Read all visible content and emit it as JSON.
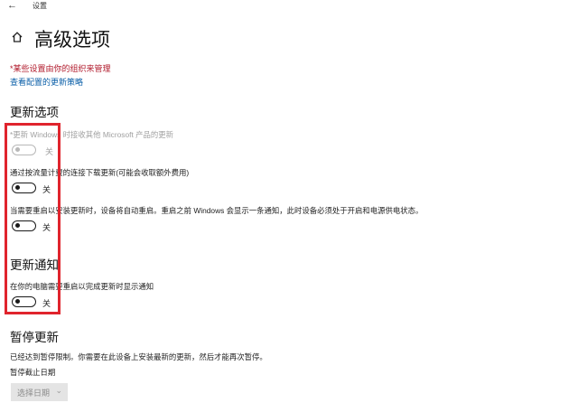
{
  "titlebar": {
    "back_icon": "back-arrow-icon",
    "title": "设置"
  },
  "page": {
    "home_icon": "home-icon",
    "title": "高级选项"
  },
  "managed_note": "*某些设置由你的组织来管理",
  "policy_link": "查看配置的更新策略",
  "update_options": {
    "heading": "更新选项",
    "items": [
      {
        "label": "*更新 Windows 时接收其他 Microsoft 产品的更新",
        "state": "关",
        "enabled": false
      },
      {
        "label": "通过按流量计费的连接下载更新(可能会收取额外费用)",
        "state": "关",
        "enabled": true
      },
      {
        "label": "当需要重启以安装更新时，设备将自动重启。重启之前 Windows 会显示一条通知，此时设备必须处于开启和电源供电状态。",
        "state": "关",
        "enabled": true
      }
    ]
  },
  "update_notifications": {
    "heading": "更新通知",
    "items": [
      {
        "label": "在你的电脑需要重启以完成更新时显示通知",
        "state": "关",
        "enabled": true
      }
    ]
  },
  "pause": {
    "heading": "暂停更新",
    "description": "已经达到暂停限制。你需要在此设备上安装最新的更新，然后才能再次暂停。",
    "date_label": "暂停截止日期",
    "dropdown_value": "选择日期"
  },
  "colors": {
    "highlight": "#e0242d",
    "link": "#0b5fa8",
    "warning": "#b0182a"
  }
}
